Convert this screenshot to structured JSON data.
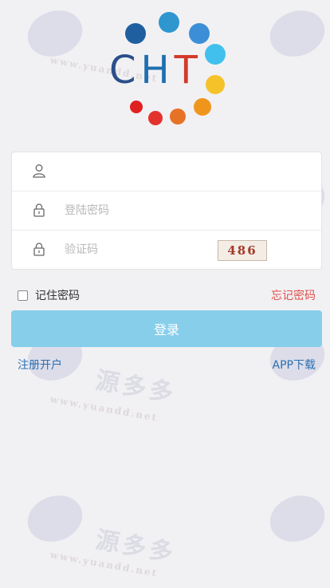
{
  "header": {
    "logo_text": [
      "C",
      "H",
      "T"
    ],
    "dot_colors": [
      "#1f5fa0",
      "#2f96cf",
      "#3c8fd6",
      "#41c0ee",
      "#f5c22a",
      "#f0951c",
      "#e67226",
      "#e3322d",
      "#e0201f"
    ]
  },
  "form": {
    "username": {
      "value": "",
      "placeholder": ""
    },
    "password": {
      "value": "",
      "placeholder": "登陆密码"
    },
    "captcha": {
      "value": "",
      "placeholder": "验证码",
      "image_text": "486"
    }
  },
  "remember": {
    "label": "记住密码",
    "checked": false
  },
  "forgot": {
    "label": "忘记密码"
  },
  "login_button": {
    "label": "登录"
  },
  "footer": {
    "register": "注册开户",
    "app_download": "APP下载"
  },
  "colors": {
    "background": "#f1f1f4",
    "login_button": "#87ceeb",
    "link": "#2a6fb0",
    "forgot": "#e0504a"
  }
}
